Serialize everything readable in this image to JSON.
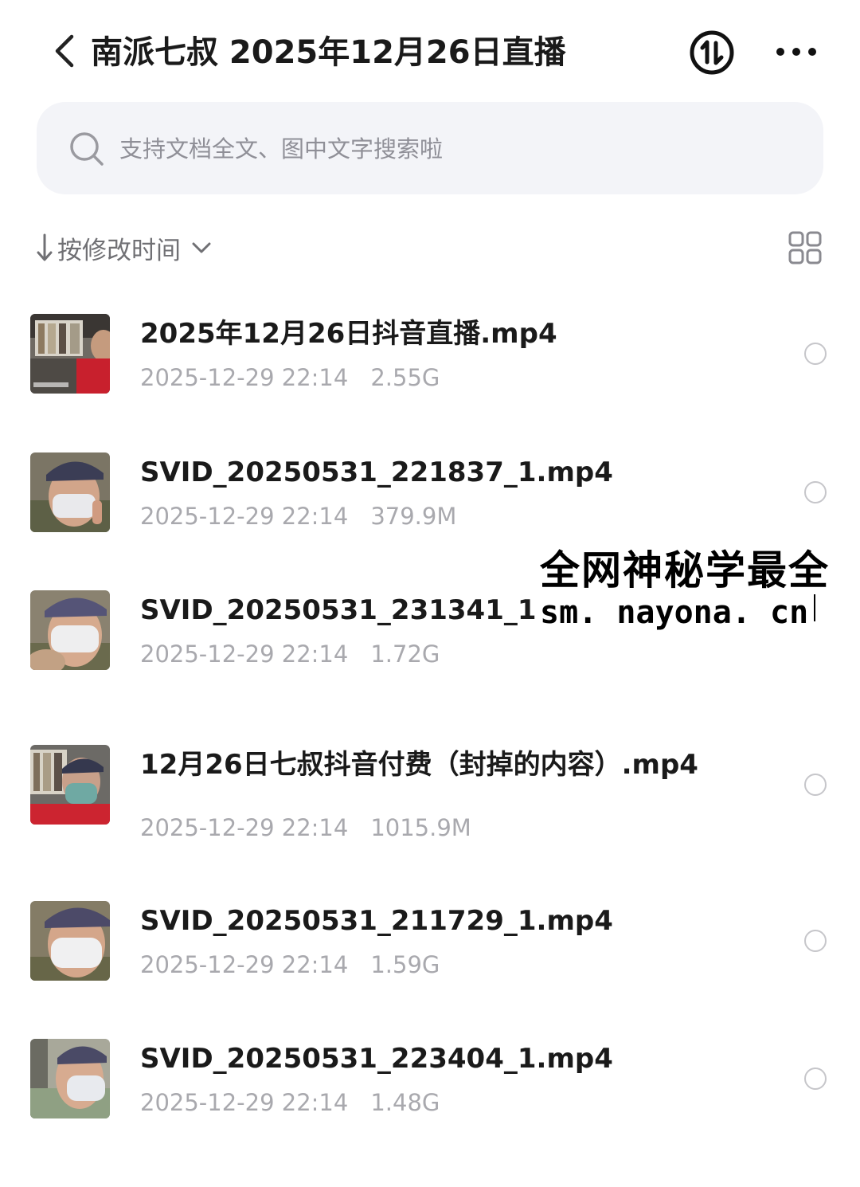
{
  "header": {
    "title": "南派七叔 2025年12月26日直播",
    "back_icon": "chevron-left-icon",
    "sort_toggle_icon": "sort-toggle-icon",
    "more_icon": "more-dots-icon"
  },
  "search": {
    "placeholder": "支持文档全文、图中文字搜索啦",
    "value": ""
  },
  "sort": {
    "label": "按修改时间",
    "direction": "descending",
    "view_icon": "grid-view-icon"
  },
  "files": [
    {
      "name": "2025年12月26日抖音直播.mp4",
      "modified": "2025-12-29 22:14",
      "size": "2.55G",
      "selected": false
    },
    {
      "name": "SVID_20250531_221837_1.mp4",
      "modified": "2025-12-29 22:14",
      "size": "379.9M",
      "selected": false
    },
    {
      "name": "SVID_20250531_231341_1.m",
      "modified": "2025-12-29 22:14",
      "size": "1.72G",
      "selected": false
    },
    {
      "name": "12月26日七叔抖音付费（封掉的内容）.mp4",
      "modified": "2025-12-29 22:14",
      "size": "1015.9M",
      "selected": false
    },
    {
      "name": "SVID_20250531_211729_1.mp4",
      "modified": "2025-12-29 22:14",
      "size": "1.59G",
      "selected": false
    },
    {
      "name": "SVID_20250531_223404_1.mp4",
      "modified": "2025-12-29 22:14",
      "size": "1.48G",
      "selected": false
    }
  ],
  "watermark": {
    "line1": "全网神秘学最全",
    "line2": "sm. nayona. cn"
  },
  "colors": {
    "background": "#ffffff",
    "search_bg": "#f3f4f8",
    "title": "#1a1a1a",
    "meta": "#a9a9ae",
    "radio_border": "#c6c6ca"
  }
}
